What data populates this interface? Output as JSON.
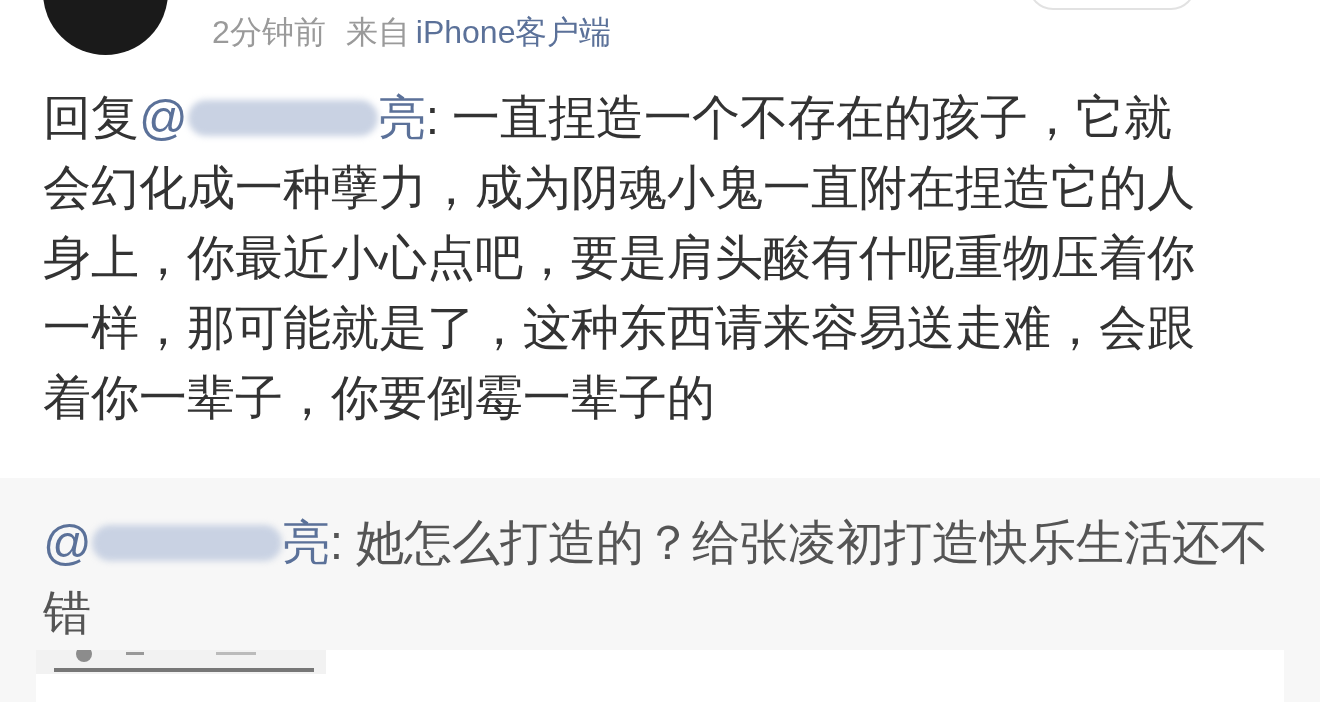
{
  "post_meta": {
    "time": "2分钟前",
    "source_prefix": "来自",
    "source": "iPhone客户端"
  },
  "reply": {
    "prefix": "回复",
    "mention": {
      "at": "@",
      "name_end": "亮"
    },
    "lines": [
      ": 一直捏造一个不存在的孩子，它就",
      "会幻化成一种孽力，成为阴魂小鬼一直附在捏造它的人",
      "身上，你最近小心点吧，要是肩头酸有什呢重物压着你",
      "一样，那可能就是了，这种东西请来容易送走难，会跟",
      "着你一辈子，你要倒霉一辈子的"
    ]
  },
  "quoted": {
    "mention": {
      "at": "@",
      "name_end": "亮"
    },
    "lines": [
      ": 她怎么打造的？给张凌初打造快乐生活还不",
      "错"
    ]
  }
}
